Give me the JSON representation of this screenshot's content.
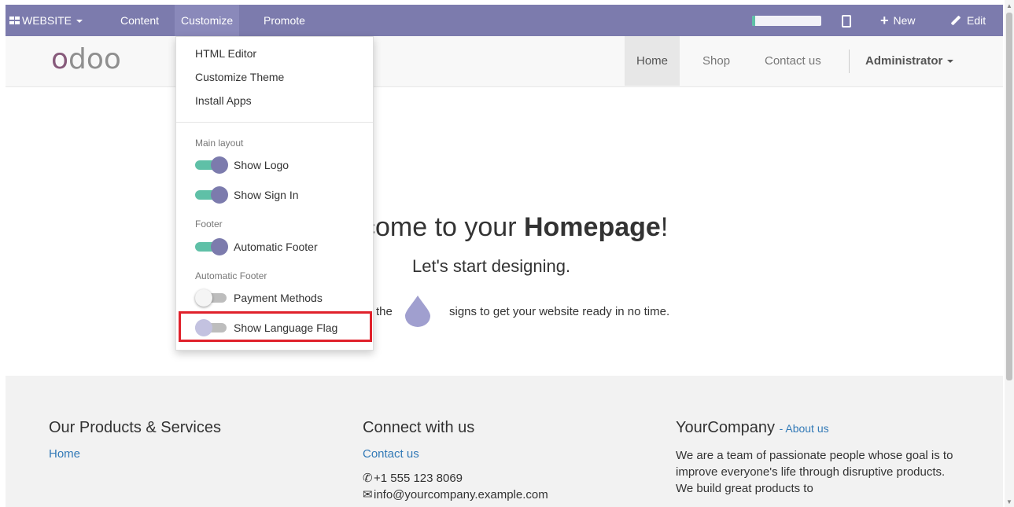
{
  "topbar": {
    "website_label": "WEBSITE",
    "menu": [
      "Content",
      "Customize",
      "Promote"
    ],
    "progress_fraction": 0.05,
    "new_label": "New",
    "edit_label": "Edit"
  },
  "header": {
    "logo_text": "odoo",
    "nav": [
      "Home",
      "Shop",
      "Contact us"
    ],
    "user": "Administrator"
  },
  "customize_menu": {
    "items": [
      "HTML Editor",
      "Customize Theme",
      "Install Apps"
    ],
    "sections": [
      {
        "title": "Main layout",
        "toggles": [
          {
            "label": "Show Logo",
            "on": true
          },
          {
            "label": "Show Sign In",
            "on": true
          }
        ]
      },
      {
        "title": "Footer",
        "toggles": [
          {
            "label": "Automatic Footer",
            "on": true
          }
        ]
      },
      {
        "title": "Automatic Footer",
        "toggles": [
          {
            "label": "Payment Methods",
            "on": false
          },
          {
            "label": "Show Language Flag",
            "on": false
          }
        ]
      }
    ]
  },
  "hero": {
    "title_prefix": "come to your ",
    "title_bold": "Homepage",
    "title_suffix": "!",
    "subtitle": "Let's start designing.",
    "hint_start": "the",
    "hint_end": "signs to get your website ready in no time."
  },
  "footer": {
    "col1": {
      "title": "Our Products & Services",
      "link": "Home"
    },
    "col2": {
      "title": "Connect with us",
      "link": "Contact us",
      "phone": "+1 555 123 8069",
      "email": "info@yourcompany.example.com"
    },
    "col3": {
      "title": "YourCompany",
      "title_link": "- About us",
      "text": "We are a team of passionate people whose goal is to improve everyone's life through disruptive products. We build great products to"
    }
  },
  "colors": {
    "brand_bar": "#7c7bad",
    "toggle_on": "#5fc0a7",
    "highlight": "#e0212b",
    "link": "#337ab7"
  }
}
